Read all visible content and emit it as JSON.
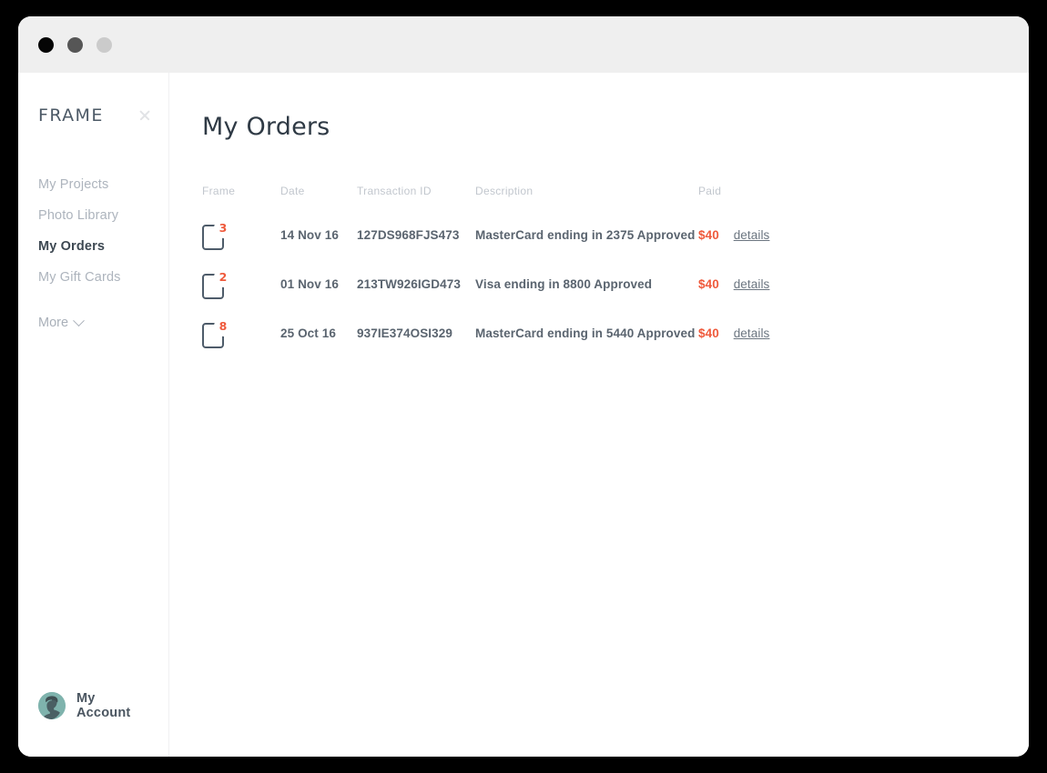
{
  "window": {
    "controls": [
      {
        "name": "close",
        "color": "#050505"
      },
      {
        "name": "minimize",
        "color": "#565656"
      },
      {
        "name": "zoom",
        "color": "#cbcbcb"
      }
    ]
  },
  "sidebar": {
    "brand": "FRAME",
    "close_icon": "close-icon",
    "items": [
      {
        "label": "My Projects",
        "active": false
      },
      {
        "label": "Photo Library",
        "active": false
      },
      {
        "label": "My Orders",
        "active": true
      },
      {
        "label": "My Gift Cards",
        "active": false
      }
    ],
    "more_label": "More",
    "more_icon": "chevron-down-icon",
    "account_label": "My Account",
    "avatar_icon": "avatar"
  },
  "main": {
    "page_title": "My Orders",
    "table": {
      "headers": [
        "Frame",
        "Date",
        "Transaction ID",
        "Description",
        "Paid"
      ],
      "rows": [
        {
          "frame_count": "3",
          "date": "14 Nov 16",
          "transaction_id": "127DS968FJS473",
          "description": "MasterCard ending in 2375 Approved",
          "paid": "$40",
          "details": "details"
        },
        {
          "frame_count": "2",
          "date": "01 Nov 16",
          "transaction_id": "213TW926IGD473",
          "description": "Visa ending in 8800 Approved",
          "paid": "$40",
          "details": "details"
        },
        {
          "frame_count": "8",
          "date": "25 Oct 16",
          "transaction_id": "937IE374OSI329",
          "description": "MasterCard ending in 5440 Approved",
          "paid": "$40",
          "details": "details"
        }
      ]
    }
  },
  "colors": {
    "accent": "#ef5a3c",
    "text_dark": "#3d4852",
    "text_muted": "#adb4bd",
    "titlebar": "#efefef"
  }
}
